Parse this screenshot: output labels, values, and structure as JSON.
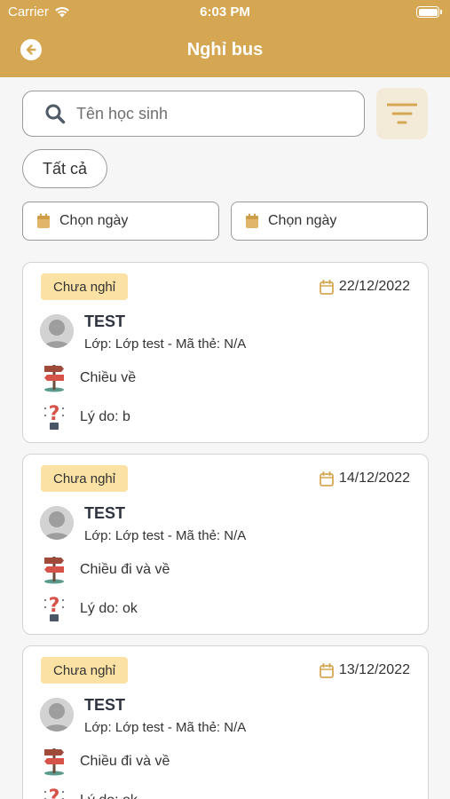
{
  "status_bar": {
    "carrier": "Carrier",
    "time": "6:03 PM"
  },
  "header": {
    "title": "Nghỉ bus"
  },
  "search": {
    "placeholder": "Tên học sinh"
  },
  "filter_chip": {
    "label": "Tất cả"
  },
  "date_filters": {
    "from_label": "Chọn ngày",
    "to_label": "Chọn ngày"
  },
  "labels": {
    "class_prefix": "Lớp: ",
    "card_prefix": " - Mã thẻ: ",
    "reason_prefix": "Lý do: "
  },
  "colors": {
    "header": "#d6a752",
    "badge": "#fbe2a4",
    "accent": "#d6a752"
  },
  "cards": [
    {
      "status": "Chưa nghỉ",
      "date": "22/12/2022",
      "name": "TEST",
      "subtitle": "Lớp: Lớp test - Mã thẻ: N/A",
      "route": "Chiều về",
      "reason": "Lý do: b"
    },
    {
      "status": "Chưa nghỉ",
      "date": "14/12/2022",
      "name": "TEST",
      "subtitle": "Lớp: Lớp test - Mã thẻ: N/A",
      "route": "Chiều đi và về",
      "reason": "Lý do: ok"
    },
    {
      "status": "Chưa nghỉ",
      "date": "13/12/2022",
      "name": "TEST",
      "subtitle": "Lớp: Lớp test - Mã thẻ: N/A",
      "route": "Chiều đi và về",
      "reason": "Lý do: ok"
    }
  ]
}
